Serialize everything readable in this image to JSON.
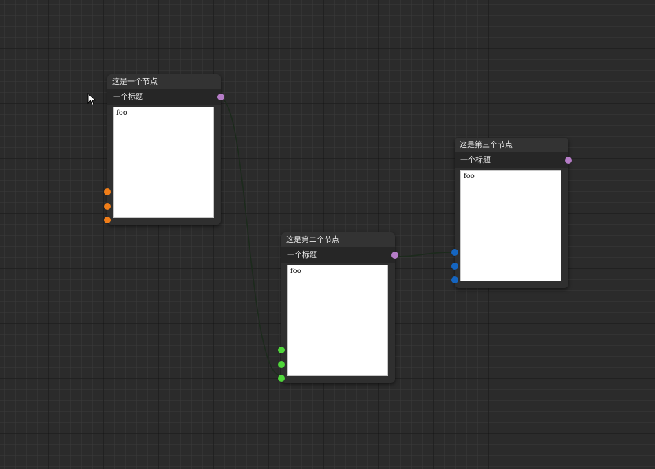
{
  "colors": {
    "canvas_background": "#2b2b2b",
    "edge": "#1c2a1c",
    "output_port": "#b57cc7",
    "node1_input_port": "#f07d18",
    "node2_input_port": "#4fd63a",
    "node3_input_port": "#1565c0"
  },
  "nodes": [
    {
      "title": "这是一个节点",
      "subtitle": "一个标题",
      "content": "foo",
      "input_port_count": 3,
      "output_port_count": 1
    },
    {
      "title": "这是第二个节点",
      "subtitle": "一个标题",
      "content": "foo",
      "input_port_count": 3,
      "output_port_count": 1
    },
    {
      "title": "这是第三个节点",
      "subtitle": "一个标题",
      "content": "foo",
      "input_port_count": 3,
      "output_port_count": 1
    }
  ],
  "connections": [
    {
      "from_node": 1,
      "from_port": "output-1",
      "to_node": 2,
      "to_port": "input-3"
    },
    {
      "from_node": 2,
      "from_port": "output-1",
      "to_node": 3,
      "to_port": "input-1"
    }
  ],
  "cursor": {
    "icon": "arrow-cursor-icon"
  }
}
